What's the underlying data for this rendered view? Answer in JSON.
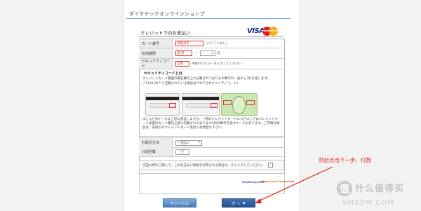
{
  "shop": {
    "title": "ダイヤテックオンラインショップ"
  },
  "payment": {
    "section_title": "クレジットでのお支払い",
    "brands": {
      "visa": "VISA",
      "mastercard": "MasterCard"
    }
  },
  "form": {
    "card_number": {
      "label": "カード番号",
      "value": "半角英字",
      "hint": "(ハイフンなし)"
    },
    "expiry": {
      "label": "有効期限",
      "month_value": "年/月",
      "separator": "／",
      "year_select": "–",
      "year_unit": "年"
    },
    "security_code": {
      "label": "セキュリティコード",
      "value": "全角",
      "hint": "半角ｾｷｭﾘﾃｨｺｰﾄﾞを入力してください"
    },
    "security_help": {
      "heading": "セキュリティコードとは",
      "text": "クレジットカード裏面の署名欄の上に記載されております数字の、右から3桁を指します。(\"1234 567\"と記載されている場合は\"567\"がセキュリティコード)",
      "note": "ほとんどのケースは上記に該当しますが、一部のクレジットカードにつきましてはクレジットカード表面のカード番号上部に記載されております4桁の数字を指すケースもあります。ご不明な場合は、お持ちのクレジットカード会社にお問合せ下さい。"
    },
    "payment_method": {
      "label": "お取引方法",
      "value": "一括払い"
    },
    "installments": {
      "label": "分割回数",
      "value": "回"
    }
  },
  "checkbox": {
    "label": "次回以降のご購入で、このお支払い情報を利用される場合は、チェックしてください。"
  },
  "logos": {
    "left": "Verified by VISA",
    "right": "MasterCard SecureCode"
  },
  "buttons": {
    "cancel": "キャンセル",
    "next": "次 へ"
  },
  "annotation": {
    "text": "然后点击下一步，付款"
  },
  "watermark": {
    "glyph": "值",
    "text": "什么值得买",
    "sub": "SMZDM.COM"
  },
  "colors": {
    "annotation": "#e32222",
    "header_rule": "#6fa3d9",
    "button": "#2c5a9e"
  }
}
